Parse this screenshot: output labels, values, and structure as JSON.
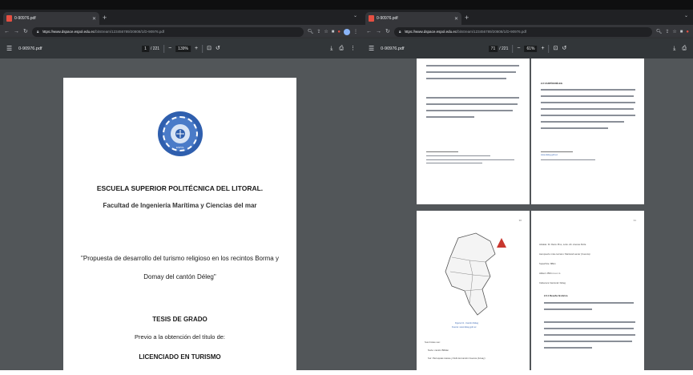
{
  "left_window": {
    "tab_title": "0-90976.pdf",
    "url_host": "https://www.dspace.espol.edu.ec",
    "url_path": "/bitstream/123456789/20808/1/D-90976.pdf",
    "toolbar": {
      "doc_title": "0-90976.pdf",
      "page_current": "1",
      "page_total": "/ 221",
      "zoom": "139%"
    }
  },
  "right_window": {
    "tab_title": "0-90976.pdf",
    "url_host": "https://www.dspace.espol.edu.ec",
    "url_path": "/bitstream/123456789/20808/1/D-90976.pdf",
    "toolbar": {
      "doc_title": "0-90976.pdf",
      "page_current": "71",
      "page_total": "/ 221",
      "zoom": "61%"
    }
  },
  "cover": {
    "seal_text": "ESPOL",
    "institution": "ESCUELA SUPERIOR POLITÉCNICA DEL LITORAL.",
    "faculty": "Facultad de Ingeniería Marítima y Ciencias del mar",
    "title_line1": "\"Propuesta de desarrollo del turismo religioso en los recintos Borma y",
    "title_line2": "Domay del cantón Déleg\"",
    "thesis": "TESIS DE GRADO",
    "prev": "Previo a la obtención del título de:",
    "degree": "LICENCIADO EN TURISMO"
  },
  "right_pages": {
    "heading_canton": "2.2 CANTÓN DÉLEG",
    "footnote_link": "www.deleg.gob.ec",
    "map_caption": "Figura 13 - Cantón Déleg",
    "map_caption2": "Fuente: www.deleg.gob.ec",
    "lower_left_label": "Sus límites son:",
    "lower_left_item1": "Norte: cantón Biblián",
    "lower_left_item2": "Sur: Parroquias Llacao y Nulti del cantón Cuenca (Azuay)",
    "info_alcalde": "Alcalde: Dr. Darío Pino, Lcdo. Ab. Arenas Peña",
    "info_aeropuerto": "Aeropuerto más cercano: Mariscal Lamar (Cuenca)",
    "info_superficie": "Superficie: 88km",
    "info_altitud": "Altitud: 2564 m.s.n.m",
    "info_cabecera": "Cabecera Cantonal: Déleg",
    "heading_historia": "2.2.1 Reseña histórica",
    "page_marker_1": "30",
    "page_marker_2": "31"
  }
}
